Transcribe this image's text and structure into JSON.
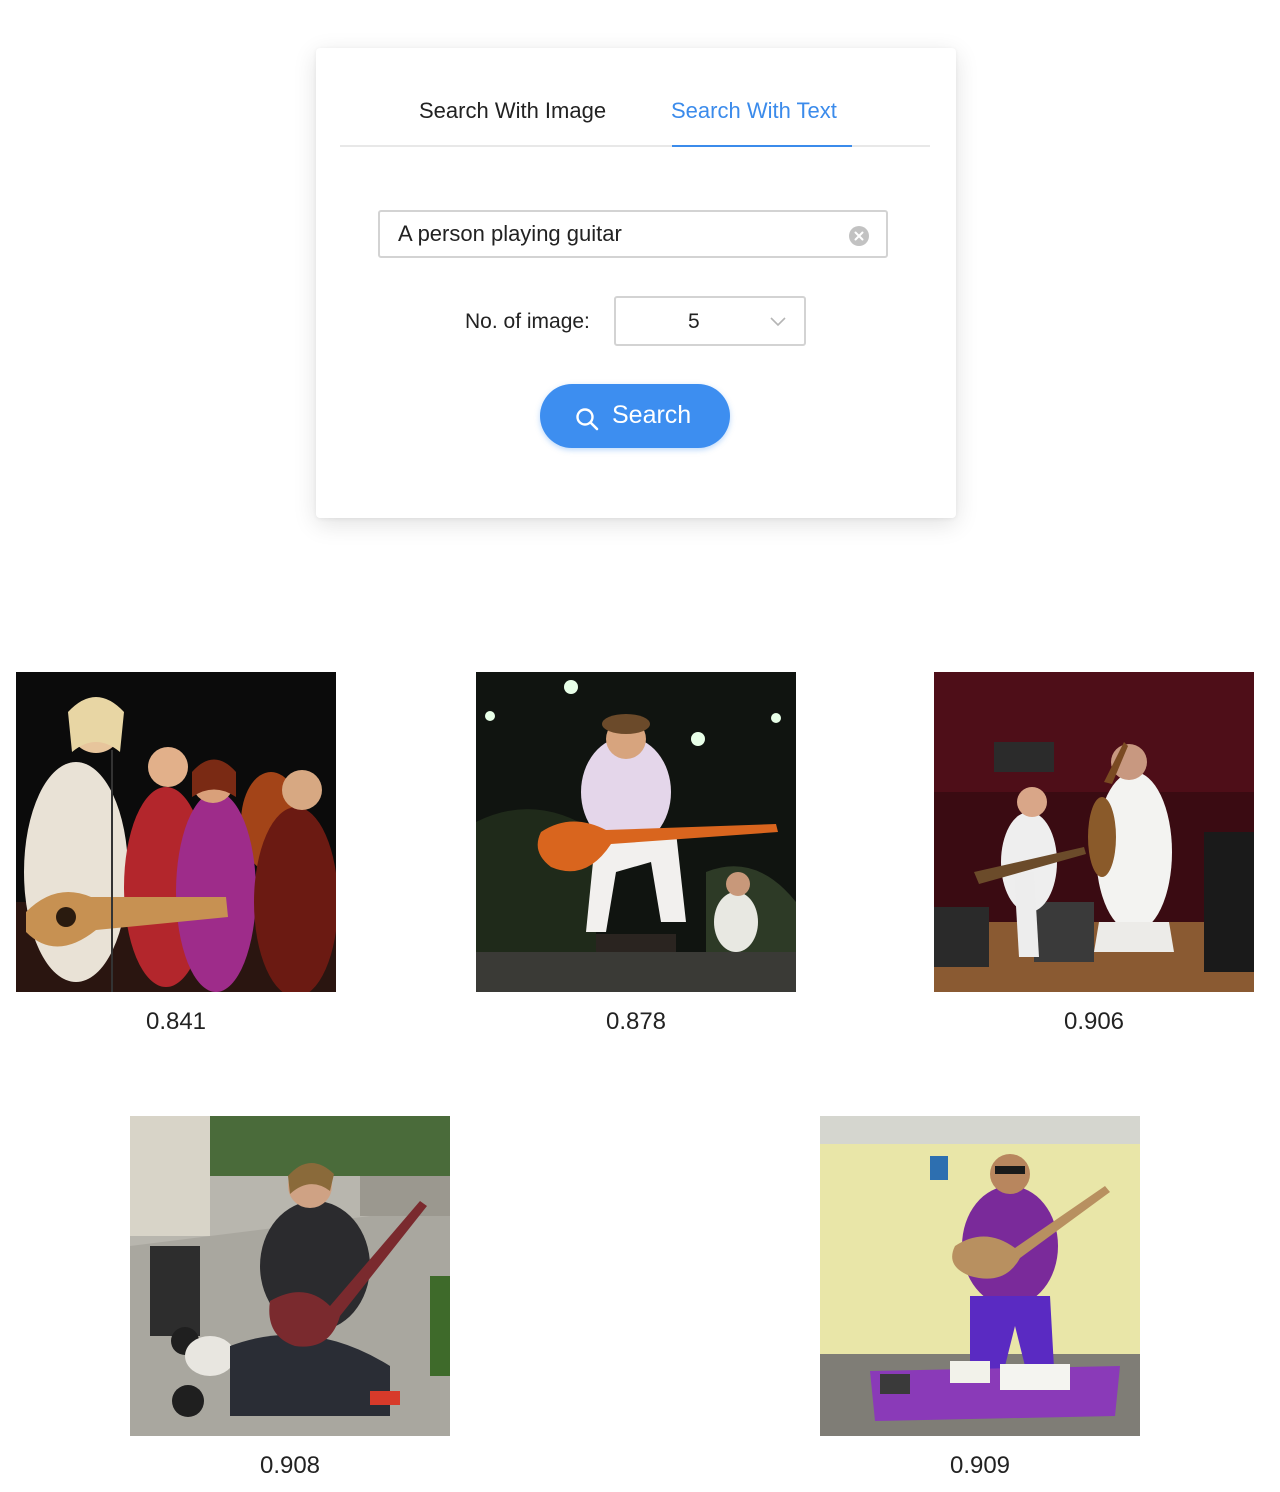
{
  "tabs": [
    {
      "label": "Search With Image"
    },
    {
      "label": "Search With Text",
      "active": true
    }
  ],
  "search": {
    "value": "A person playing guitar",
    "clear_icon": "close-circle-icon"
  },
  "count": {
    "label": "No. of image:",
    "value": "5",
    "icon": "chevron-down-icon"
  },
  "search_button": {
    "label": "Search",
    "icon": "search-icon",
    "color": "#3d8ef0"
  },
  "accent_color": "#3b8beb",
  "results": [
    {
      "score": "0.841"
    },
    {
      "score": "0.878"
    },
    {
      "score": "0.906"
    },
    {
      "score": "0.908"
    },
    {
      "score": "0.909"
    }
  ]
}
